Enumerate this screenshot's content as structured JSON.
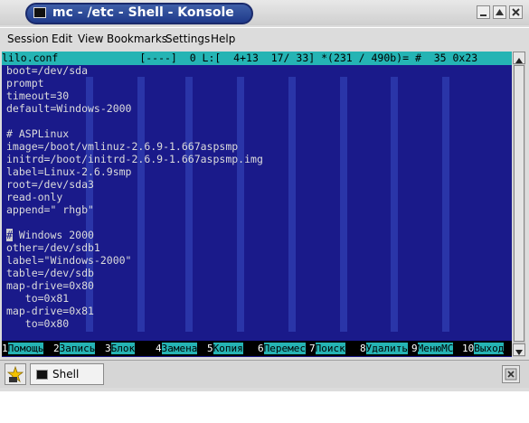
{
  "window": {
    "title": "mc - /etc - Shell - Konsole",
    "controls": [
      "minimize",
      "maximize",
      "close"
    ]
  },
  "menubar": [
    "Session",
    "Edit",
    "View",
    "Bookmarks",
    "Settings",
    "Help"
  ],
  "editor": {
    "status": "lilo.conf             [----]  0 L:[  4+13  17/ 33] *(231 / 490b)= #  35 0x23",
    "lines": [
      "boot=/dev/sda",
      "prompt",
      "timeout=30",
      "default=Windows-2000",
      "",
      "# ASPLinux",
      "image=/boot/vmlinuz-2.6.9-1.667aspsmp",
      "initrd=/boot/initrd-2.6.9-1.667aspsmp.img",
      "label=Linux-2.6.9smp",
      "root=/dev/sda3",
      "read-only",
      "append=\" rhgb\"",
      "",
      "# Windows 2000",
      "other=/dev/sdb1",
      "label=\"Windows-2000\"",
      "table=/dev/sdb",
      "map-drive=0x80",
      "   to=0x81",
      "map-drive=0x81",
      "   to=0x80"
    ],
    "cursor_char": "#",
    "cursor_rest": " Windows 2000"
  },
  "fkeys": [
    {
      "num": "1",
      "label": "Помощь"
    },
    {
      "num": "2",
      "label": "Запись"
    },
    {
      "num": "3",
      "label": "Блок"
    },
    {
      "num": "4",
      "label": "Замена"
    },
    {
      "num": "5",
      "label": "Копия"
    },
    {
      "num": "6",
      "label": "Перемес"
    },
    {
      "num": "7",
      "label": "Поиск"
    },
    {
      "num": "8",
      "label": "Удалить"
    },
    {
      "num": "9",
      "label": "МенюМС"
    },
    {
      "num": "10",
      "label": "Выход"
    }
  ],
  "tabbar": {
    "tab_label": "Shell"
  },
  "colors": {
    "terminal_bg": "#1a1a8a",
    "status_bg": "#25b4b4",
    "title_bg": "#1f3a8a"
  }
}
